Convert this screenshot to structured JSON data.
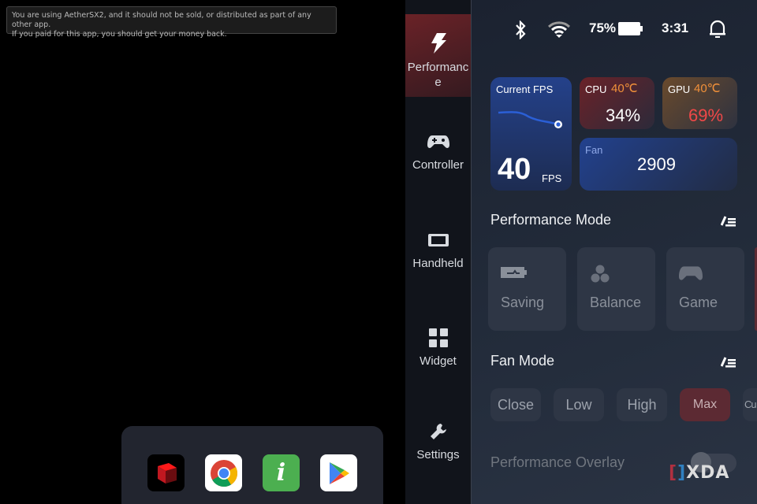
{
  "toast": {
    "line1": "You are using AetherSX2, and it should not be sold, or distributed as part of any other app.",
    "line2": "If you paid for this app, you should get your money back."
  },
  "dock": {
    "apps": [
      "aethersx2-icon",
      "chrome-icon",
      "info-icon",
      "play-store-icon"
    ]
  },
  "sidebar": {
    "items": [
      {
        "label": "Performanc e",
        "icon": "lightning-icon",
        "active": true
      },
      {
        "label": "Controller",
        "icon": "gamepad-icon"
      },
      {
        "label": "Handheld",
        "icon": "handheld-icon"
      },
      {
        "label": "Widget",
        "icon": "grid-icon"
      },
      {
        "label": "Settings",
        "icon": "wrench-icon"
      }
    ]
  },
  "status": {
    "battery": "75%",
    "time": "3:31"
  },
  "stats": {
    "fps_label": "Current FPS",
    "fps_value": "40",
    "fps_unit": "FPS",
    "cpu_label": "CPU",
    "cpu_temp": "40℃",
    "cpu_usage": "34%",
    "gpu_label": "GPU",
    "gpu_temp": "40℃",
    "gpu_usage": "69%",
    "fan_label": "Fan",
    "fan_value": "2909"
  },
  "performance_mode": {
    "title": "Performance Mode",
    "modes": [
      "Saving",
      "Balance",
      "Game"
    ]
  },
  "fan_mode": {
    "title": "Fan Mode",
    "options": [
      "Close",
      "Low",
      "High",
      "Max",
      "Cu"
    ],
    "selected": "Max"
  },
  "overlay": {
    "label": "Performance Overlay",
    "enabled": false
  },
  "watermark": "XDA",
  "colors": {
    "accent_red": "#5c2a33",
    "temp_orange": "#f0903a",
    "gpu_red": "#f04848"
  }
}
